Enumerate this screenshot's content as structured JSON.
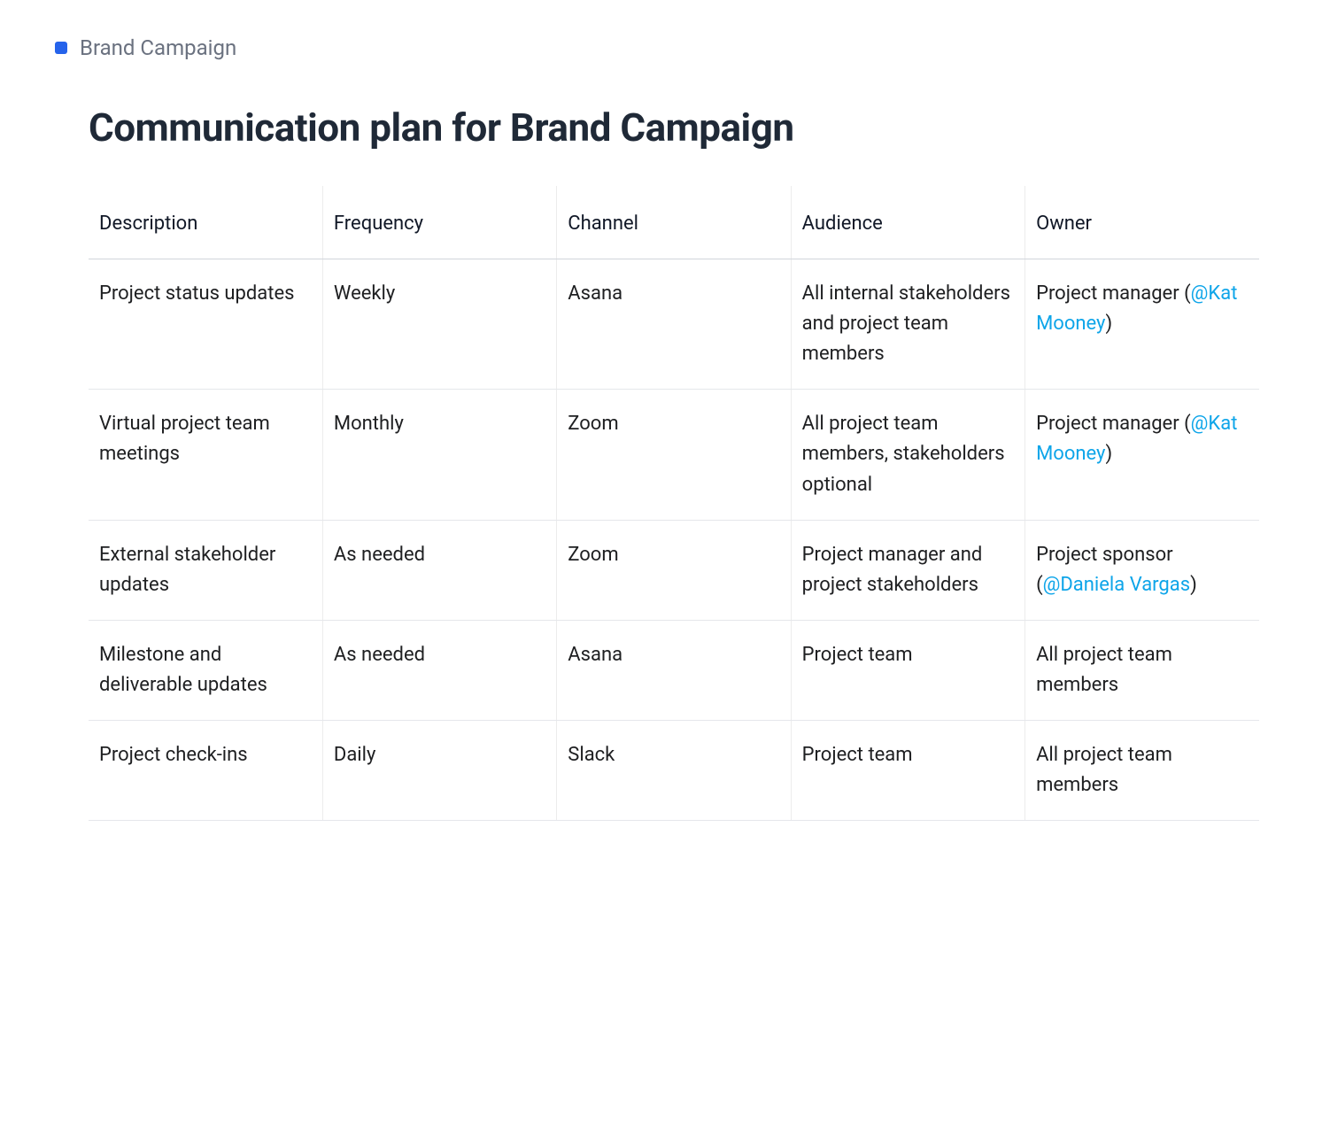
{
  "breadcrumb": {
    "label": "Brand Campaign"
  },
  "title": "Communication plan for Brand Campaign",
  "table": {
    "headers": [
      "Description",
      "Frequency",
      "Channel",
      "Audience",
      "Owner"
    ],
    "rows": [
      {
        "description": "Project status updates",
        "frequency": "Weekly",
        "channel": "Asana",
        "audience": "All internal stakeholders and project team members",
        "owner_prefix": "Project manager (",
        "owner_mention": "@Kat Mooney",
        "owner_suffix": ")"
      },
      {
        "description": "Virtual project team meetings",
        "frequency": "Monthly",
        "channel": "Zoom",
        "audience": "All project team members, stakeholders optional",
        "owner_prefix": "Project manager (",
        "owner_mention": "@Kat Mooney",
        "owner_suffix": ")"
      },
      {
        "description": "External stakeholder updates",
        "frequency": "As needed",
        "channel": "Zoom",
        "audience": "Project manager and project stakeholders",
        "owner_prefix": "Project sponsor (",
        "owner_mention": "@Daniela Vargas",
        "owner_suffix": ")"
      },
      {
        "description": "Milestone and deliverable updates",
        "frequency": "As needed",
        "channel": "Asana",
        "audience": "Project team",
        "owner_prefix": "All project team members",
        "owner_mention": "",
        "owner_suffix": ""
      },
      {
        "description": "Project check-ins",
        "frequency": "Daily",
        "channel": "Slack",
        "audience": "Project team",
        "owner_prefix": "All project team members",
        "owner_mention": "",
        "owner_suffix": ""
      }
    ]
  }
}
